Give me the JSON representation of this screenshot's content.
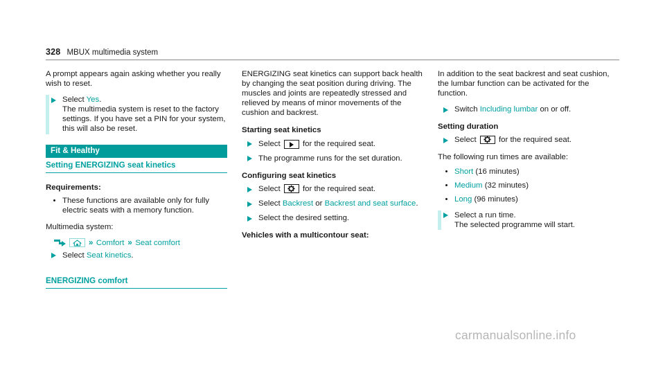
{
  "runhead": {
    "page_number": "328",
    "chapter": "MBUX multimedia system"
  },
  "left_column": {
    "intro": "A prompt appears again asking whether you really wish to reset.",
    "step_select_yes": {
      "prefix": "Select ",
      "link": "Yes",
      "suffix": ".",
      "detail": "The multimedia system is reset to the factory settings. If you have set a PIN for your system, this will also be reset."
    },
    "banner": "Fit & Healthy",
    "section_heading": "Setting ENERGIZING seat kinetics",
    "requirements_heading": "Requirements:",
    "requirement_item": "These functions are available only for fully electric seats with a memory function.",
    "multimedia_label": "Multimedia system:",
    "nav_path": {
      "entry_icon": "entry-arrow-icon",
      "home_icon": "home-icon",
      "separator": "»",
      "item_1": "Comfort",
      "item_2": "Seat comfort"
    },
    "step_select_seat_kinetics": {
      "prefix": "Select ",
      "link": "Seat kinetics",
      "suffix": "."
    },
    "closing_heading": "ENERGIZING comfort"
  },
  "middle_column": {
    "intro": "ENERGIZING seat kinetics can support back health by changing the seat position during driving. The muscles and joints are repeatedly stressed and relieved by means of minor movements of the cushion and backrest.",
    "starting_heading": "Starting seat kinetics",
    "step_select_play": {
      "prefix": "Select ",
      "icon": "play-icon",
      "suffix": " for the required seat."
    },
    "step_programme_runs": "The programme runs for the set duration.",
    "configuring_heading": "Configuring seat kinetics",
    "step_select_gear": {
      "prefix": "Select ",
      "icon": "gear-icon",
      "suffix": " for the required seat."
    },
    "step_select_backrest": {
      "prefix": "Select ",
      "link_1": "Backrest",
      "middle": " or ",
      "link_2": "Backrest and seat surface",
      "suffix": "."
    },
    "step_select_setting": "Select the desired setting.",
    "multicontour_heading": "Vehicles with a multicontour seat:"
  },
  "right_column": {
    "intro": "In addition to the seat backrest and seat cushion, the lumbar function can be activated for the function.",
    "step_switch_lumbar": {
      "prefix": "Switch ",
      "link": "Including lumbar",
      "suffix": " on or off."
    },
    "duration_heading": "Setting duration",
    "step_select_gear": {
      "prefix": "Select ",
      "icon": "gear-icon",
      "suffix": " for the required seat."
    },
    "run_times_intro": "The following run times are available:",
    "run_times": [
      {
        "name": "Short",
        "value": "(16 minutes)"
      },
      {
        "name": "Medium",
        "value": "(32 minutes)"
      },
      {
        "name": "Long",
        "value": "(96 minutes)"
      }
    ],
    "step_select_run_time": {
      "text": "Select a run time.",
      "detail": "The selected programme will start."
    }
  },
  "watermark": "carmanualsonline.info",
  "colors": {
    "teal": "#009b9b",
    "teal_text": "#00a0a0",
    "change_bar": "#c4efef",
    "body_text": "#1a1a1a",
    "watermark": "#b6b6b6"
  }
}
